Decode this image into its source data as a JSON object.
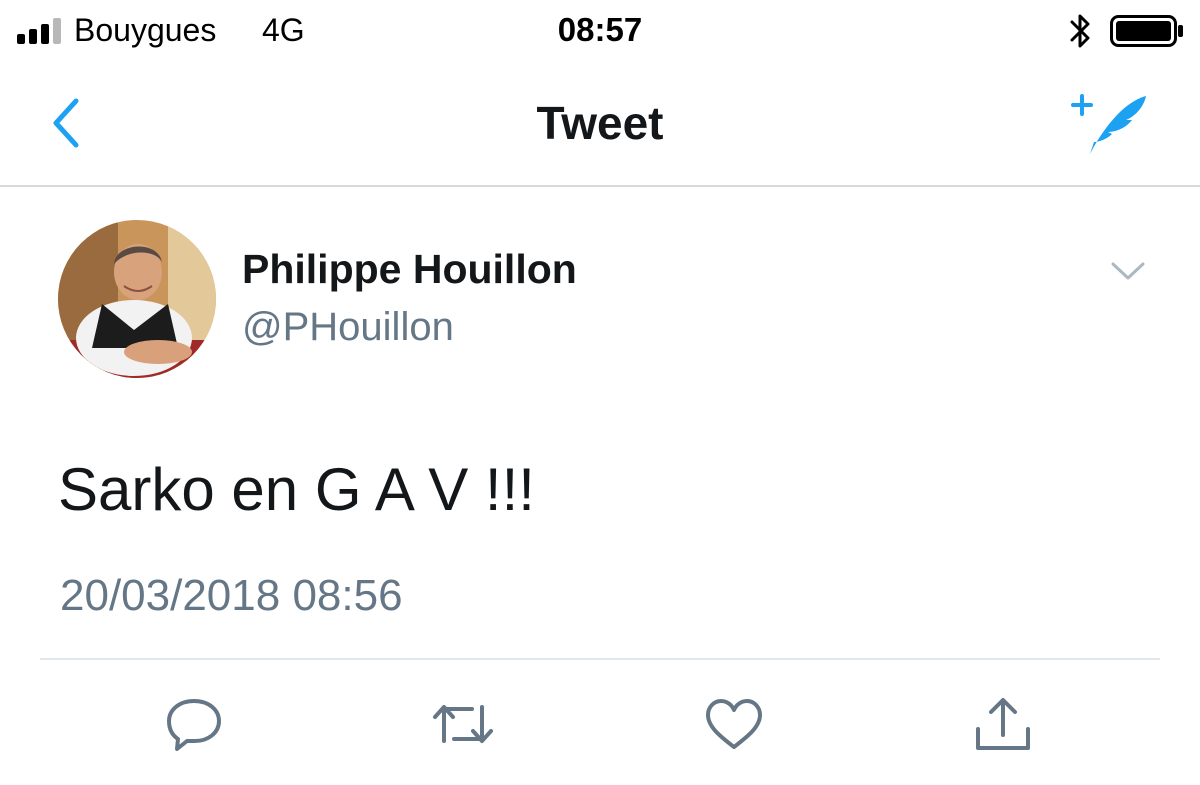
{
  "status_bar": {
    "carrier": "Bouygues",
    "network": "4G",
    "time": "08:57"
  },
  "nav": {
    "title": "Tweet"
  },
  "tweet": {
    "author_name": "Philippe Houillon",
    "author_handle": "@PHouillon",
    "text": "Sarko en G A V !!!",
    "timestamp": "20/03/2018 08:56"
  },
  "icons": {
    "back": "chevron-left-icon",
    "compose": "compose-tweet-icon",
    "more": "chevron-down-icon",
    "reply": "reply-icon",
    "retweet": "retweet-icon",
    "like": "heart-icon",
    "share": "share-icon",
    "bluetooth": "bluetooth-icon",
    "battery": "battery-icon",
    "signal": "signal-icon"
  },
  "colors": {
    "accent": "#1da1f2",
    "text_primary": "#14171a",
    "text_secondary": "#657786",
    "action_icon": "#657786",
    "divider": "#e1e8ed"
  }
}
